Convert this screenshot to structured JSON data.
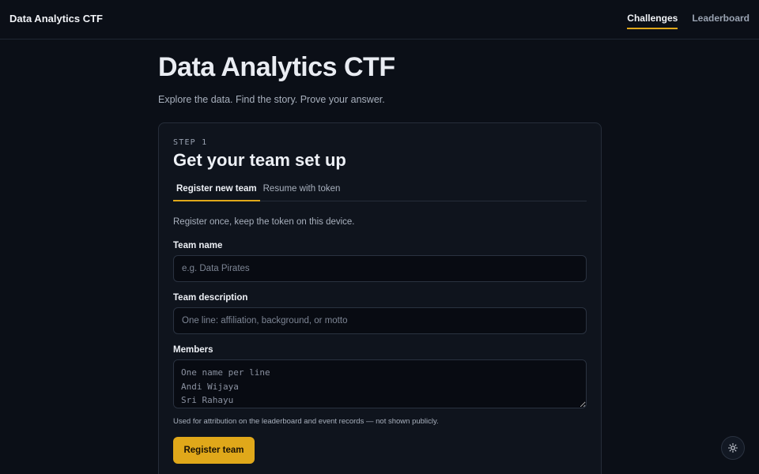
{
  "header": {
    "brand": "Data Analytics CTF",
    "nav": [
      {
        "label": "Challenges",
        "active": true
      },
      {
        "label": "Leaderboard",
        "active": false
      }
    ]
  },
  "hero": {
    "title": "Data Analytics CTF",
    "subtitle": "Explore the data. Find the story. Prove your answer."
  },
  "card": {
    "step": "STEP 1",
    "title": "Get your team set up",
    "tabs": [
      {
        "label": "Register new team",
        "active": true
      },
      {
        "label": "Resume with token",
        "active": false
      }
    ],
    "intro": "Register once, keep the token on this device.",
    "team_name": {
      "label": "Team name",
      "value": "",
      "placeholder": "e.g. Data Pirates"
    },
    "team_description": {
      "label": "Team description",
      "value": "",
      "placeholder": "One line: affiliation, background, or motto"
    },
    "members": {
      "label": "Members",
      "value": "",
      "placeholder": "One name per line\nAndi Wijaya\nSri Rahayu"
    },
    "hint": "Used for attribution on the leaderboard and event records — not shown publicly.",
    "submit_label": "Register team"
  },
  "theme_toggle": {
    "icon": "sun-icon"
  },
  "colors": {
    "accent": "#e0a81a",
    "background": "#0b0f17",
    "card": "#0f141d"
  }
}
